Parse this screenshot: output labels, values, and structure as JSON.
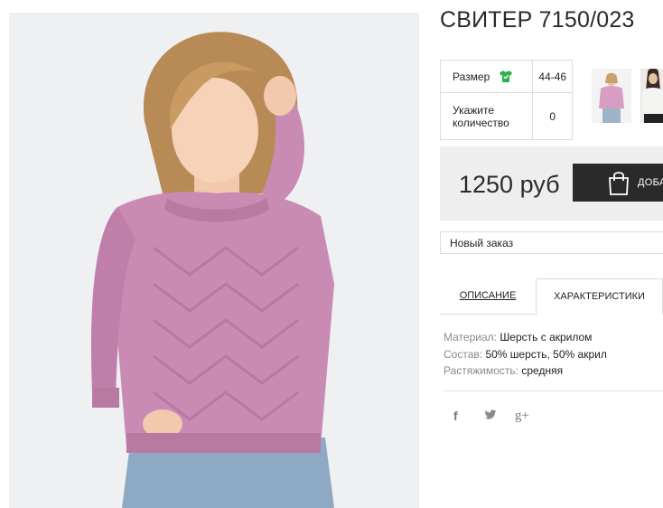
{
  "product": {
    "title": "СВИТЕР 7150/023"
  },
  "options": {
    "size_label": "Размер",
    "size_value": "44-46",
    "quantity_label": "Укажите количество",
    "quantity_value": "0"
  },
  "thumbnails": [
    {
      "icon": "thumbnail-pink-sweater"
    },
    {
      "icon": "thumbnail-white-sweater"
    }
  ],
  "price": {
    "amount": "1250 руб",
    "buy_label": "ДОБАВИТЬ В КОРЗИНУ"
  },
  "order": {
    "selected": "Новый заказ"
  },
  "tabs": [
    {
      "label": "ОПИСАНИЕ",
      "active": false
    },
    {
      "label": "ХАРАКТЕРИСТИКИ",
      "active": true
    }
  ],
  "characteristics": [
    {
      "key": "Материал:",
      "value": "Шерсть с акрилом"
    },
    {
      "key": "Состав:",
      "value": "50% шерсть, 50% акрил"
    },
    {
      "key": "Растяжимость:",
      "value": "средняя"
    }
  ],
  "social": {
    "facebook": "f",
    "twitter": "𝕥",
    "googleplus": "g+"
  },
  "colors": {
    "sweater": "#c98bb4",
    "dark_button": "#2a2a2a",
    "price_bg": "#eeeeee",
    "size_icon": "#2bb24c"
  }
}
